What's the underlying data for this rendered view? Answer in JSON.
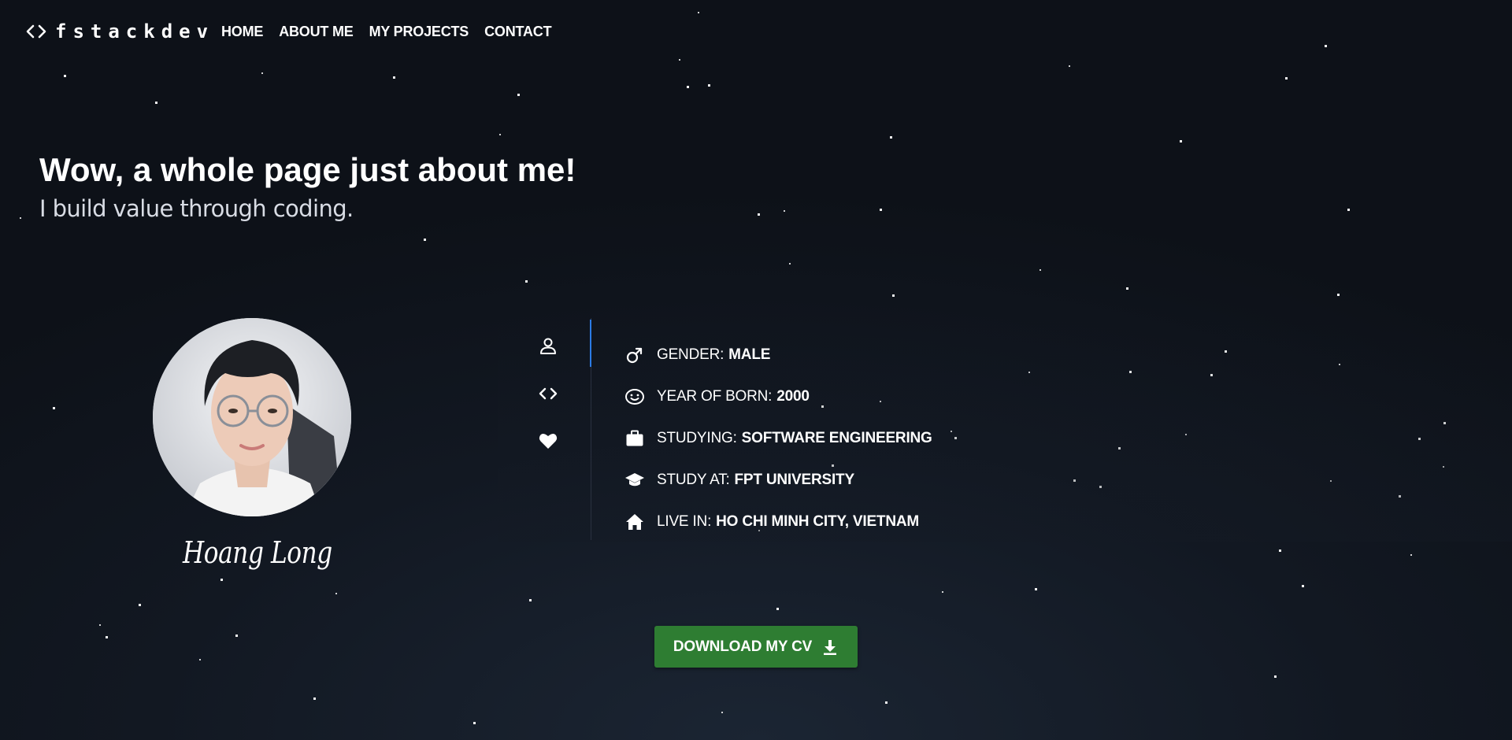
{
  "nav": {
    "logo_text": "fstackdev",
    "logo_icon": "code-brackets-icon",
    "links": [
      {
        "label": "HOME"
      },
      {
        "label": "ABOUT ME"
      },
      {
        "label": "MY PROJECTS"
      },
      {
        "label": "CONTACT"
      }
    ]
  },
  "hero": {
    "title": "Wow, a whole page just about me!",
    "subtitle": "I build value through coding."
  },
  "profile": {
    "signature": "Hoang Long"
  },
  "tabs": [
    {
      "icon": "user-icon",
      "active": true
    },
    {
      "icon": "code-brackets-icon",
      "active": false
    },
    {
      "icon": "heart-icon",
      "active": false
    }
  ],
  "info": [
    {
      "icon": "male-icon",
      "label": "GENDER: ",
      "value": "MALE"
    },
    {
      "icon": "smile-icon",
      "label": "YEAR OF BORN:",
      "value": "2000"
    },
    {
      "icon": "briefcase-icon",
      "label": "STUDYING:",
      "value": "SOFTWARE ENGINEERING"
    },
    {
      "icon": "graduation-cap-icon",
      "label": "STUDY AT:",
      "value": "FPT UNIVERSITY"
    },
    {
      "icon": "home-icon",
      "label": "LIVE IN:",
      "value": "HO CHI MINH CITY, VIETNAM"
    }
  ],
  "cta": {
    "label": "DOWNLOAD MY CV",
    "icon": "download-icon"
  },
  "colors": {
    "background": "#121822",
    "accent": "#2c7be5",
    "button": "#2e7d32"
  }
}
